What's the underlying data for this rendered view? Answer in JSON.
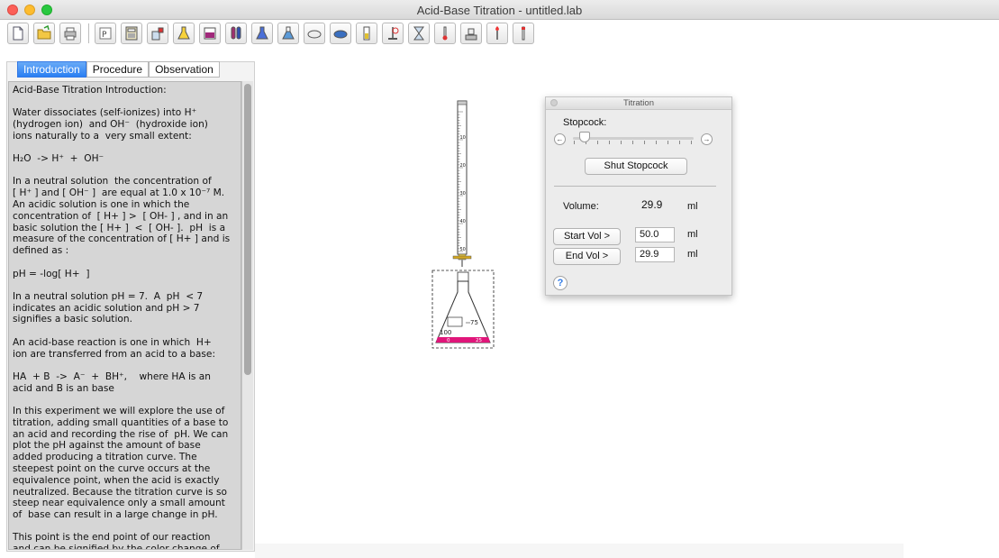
{
  "window": {
    "title": "Acid-Base Titration - untitled.lab"
  },
  "toolbar": {
    "items": [
      {
        "name": "new-document-icon"
      },
      {
        "name": "open-folder-icon"
      },
      {
        "name": "print-icon"
      },
      {
        "name": "indicator-rack-icon"
      },
      {
        "name": "calculator-icon"
      },
      {
        "name": "reagent-bottle-icon"
      },
      {
        "name": "flask-yellow-icon"
      },
      {
        "name": "beaker-purple-icon"
      },
      {
        "name": "test-tubes-icon"
      },
      {
        "name": "erlenmeyer-flask-icon"
      },
      {
        "name": "round-flask-icon"
      },
      {
        "name": "evaporating-dish-icon"
      },
      {
        "name": "petri-dish-icon"
      },
      {
        "name": "cylinder-icon"
      },
      {
        "name": "ring-stand-icon"
      },
      {
        "name": "hourglass-icon"
      },
      {
        "name": "thermometer-icon"
      },
      {
        "name": "balance-icon"
      },
      {
        "name": "burner-icon"
      },
      {
        "name": "pipette-icon"
      }
    ]
  },
  "tabs": [
    {
      "label": "Introduction",
      "active": true
    },
    {
      "label": "Procedure",
      "active": false
    },
    {
      "label": "Observation",
      "active": false
    }
  ],
  "intro": {
    "paragraphs": [
      "Acid-Base Titration Introduction:",
      "Water dissociates (self-ionizes) into H⁺\n(hydrogen ion)  and OH⁻  (hydroxide ion)\nions naturally to a  very small extent:",
      "H₂O  -> H⁺  +  OH⁻",
      "In a neutral solution  the concentration of\n[ H⁺ ] and [ OH⁻ ]  are equal at 1.0 x 10⁻⁷ M.\nAn acidic solution is one in which the\nconcentration of  [ H+ ] >  [ OH- ] , and in an\nbasic solution the [ H+ ]  <  [ OH- ].  pH  is a\nmeasure of the concentration of [ H+ ] and is\ndefined as :",
      "pH = -log[ H+  ]",
      "In a neutral solution pH = 7.  A  pH  < 7\nindicates an acidic solution and pH > 7\nsignifies a basic solution.",
      "An acid-base reaction is one in which  H+\nion are transferred from an acid to a base:",
      "HA  + B  ->  A⁻  +  BH⁺,    where HA is an\nacid and B is an base",
      "In this experiment we will explore the use of\ntitration, adding small quantities of a base to\nan acid and recording the rise of  pH. We can\nplot the pH against the amount of base\nadded producing a titration curve. The\nsteepest point on the curve occurs at the\nequivalence point, when the acid is exactly\nneutralized. Because the titration curve is so\nsteep near equivalence only a small amount\nof  base can result in a large change in pH.",
      "This point is the end point of our reaction\nand can be signified by the color change of"
    ]
  },
  "burette": {
    "tick_labels": [
      "10",
      "20",
      "30",
      "40",
      "50"
    ]
  },
  "flask": {
    "tick_labels": [
      "75",
      "100"
    ],
    "liquid_labels": [
      "0",
      "25"
    ],
    "liquid_color": "#e0167a"
  },
  "panel": {
    "title": "Titration",
    "stopcock_label": "Stopcock:",
    "stopcock_level": 0.05,
    "left_arrow": "←",
    "right_arrow": "→",
    "shut_button": "Shut Stopcock",
    "volume_label": "Volume:",
    "volume_value": "29.9",
    "volume_unit": "ml",
    "start_button": "Start Vol >",
    "start_value": "50.0",
    "start_unit": "ml",
    "end_button": "End Vol >",
    "end_value": "29.9",
    "end_unit": "ml",
    "help": "?"
  },
  "colors": {
    "tab_active": "#2f82f2",
    "text_bg": "#d6d6d6",
    "help_blue": "#2f7ae5"
  }
}
